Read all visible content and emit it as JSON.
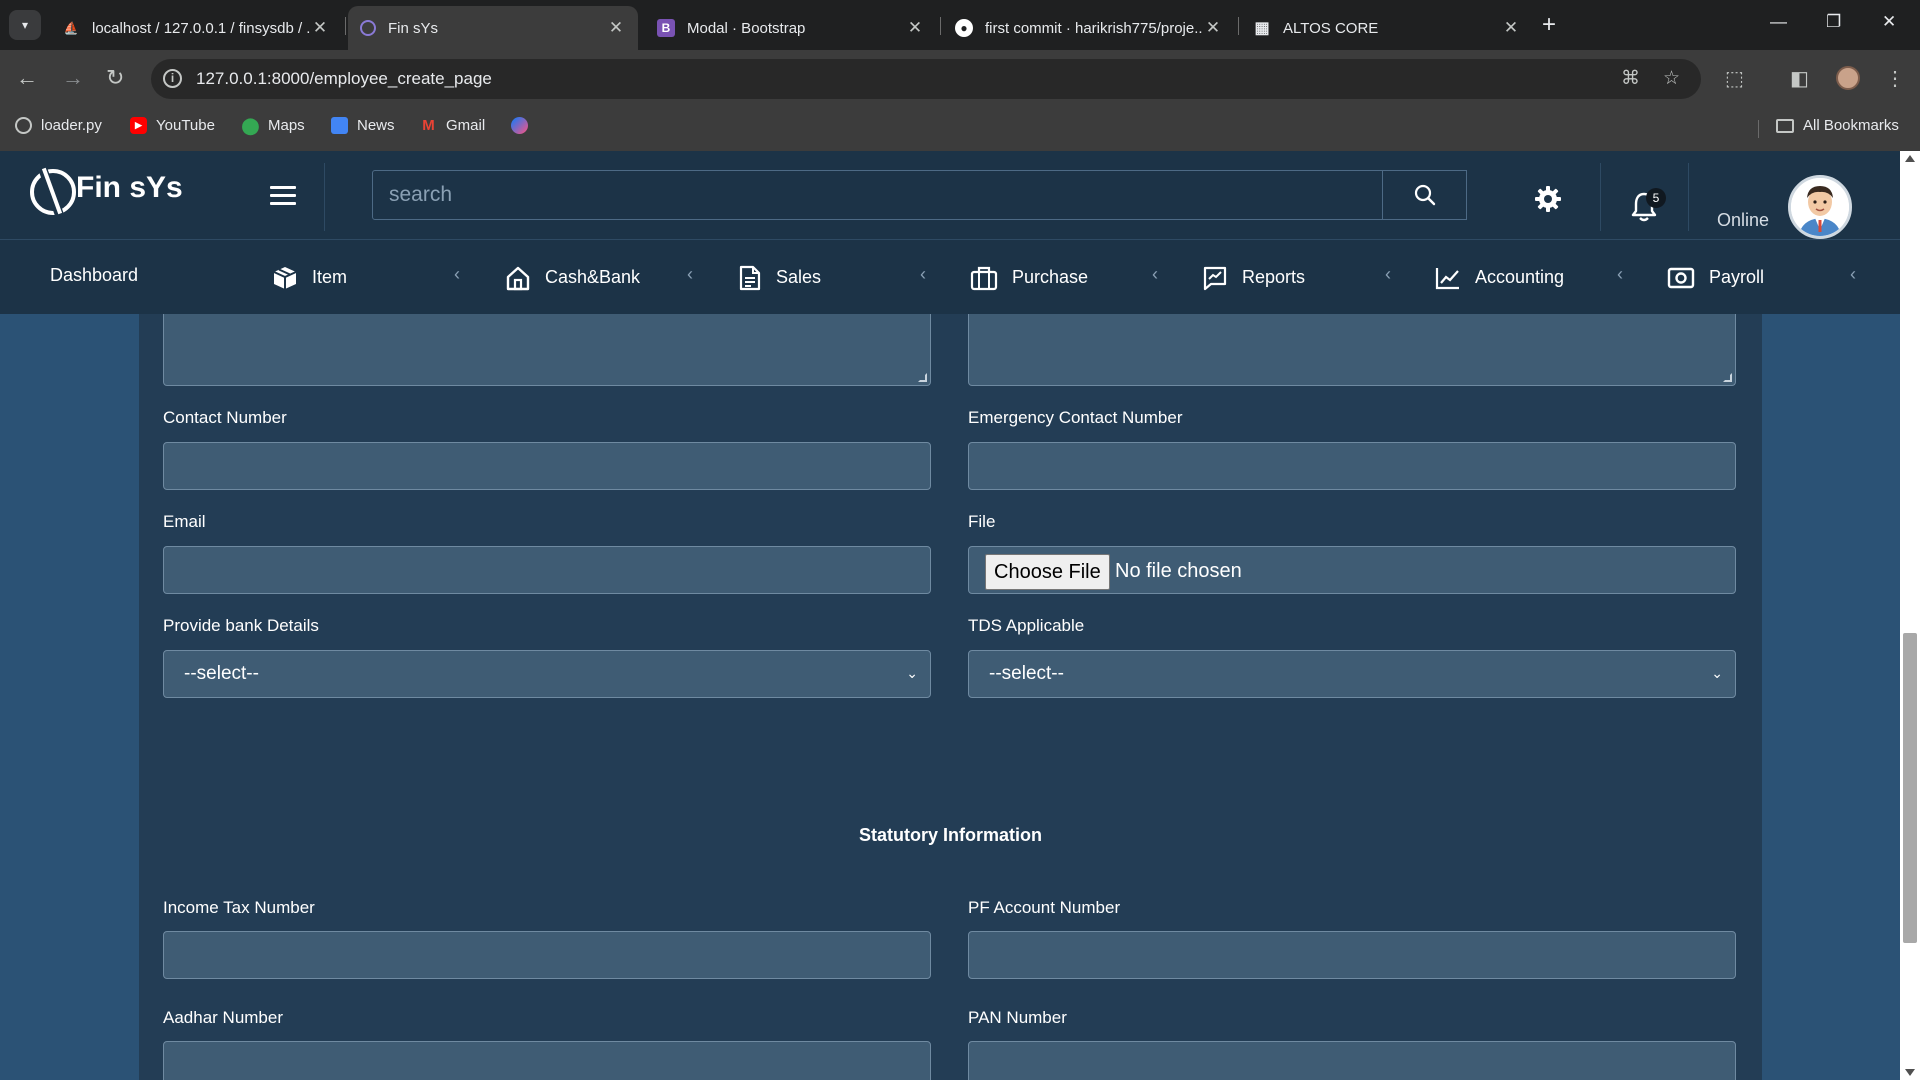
{
  "browser": {
    "tabs": [
      {
        "title": "localhost / 127.0.0.1 / finsysdb / ...",
        "icon": "phpmyadmin-icon"
      },
      {
        "title": "Fin sYs",
        "icon": "app-icon"
      },
      {
        "title": "Modal · Bootstrap",
        "icon": "bootstrap-icon"
      },
      {
        "title": "first commit · harikrish775/proje...",
        "icon": "github-icon"
      },
      {
        "title": "ALTOS CORE",
        "icon": "grid-icon"
      }
    ],
    "active_tab": 1,
    "url": "127.0.0.1:8000/employee_create_page",
    "bookmarks": [
      {
        "label": "loader.py",
        "icon": "globe-icon"
      },
      {
        "label": "YouTube",
        "icon": "youtube-icon"
      },
      {
        "label": "Maps",
        "icon": "maps-icon"
      },
      {
        "label": "News",
        "icon": "news-icon"
      },
      {
        "label": "Gmail",
        "icon": "gmail-icon"
      },
      {
        "label": "",
        "icon": "messenger-icon"
      }
    ],
    "all_bookmarks": "All Bookmarks"
  },
  "app": {
    "brand": "Fin sYs",
    "search_placeholder": "search",
    "notification_count": "5",
    "status": "Online"
  },
  "nav": [
    {
      "label": "Dashboard",
      "icon": ""
    },
    {
      "label": "Item",
      "icon": "box-icon"
    },
    {
      "label": "Cash&Bank",
      "icon": "home-icon"
    },
    {
      "label": "Sales",
      "icon": "document-icon"
    },
    {
      "label": "Purchase",
      "icon": "briefcase-icon"
    },
    {
      "label": "Reports",
      "icon": "chart-box-icon"
    },
    {
      "label": "Accounting",
      "icon": "line-chart-icon"
    },
    {
      "label": "Payroll",
      "icon": "camera-icon"
    }
  ],
  "form": {
    "contact_number": {
      "label": "Contact Number",
      "value": ""
    },
    "emergency_contact": {
      "label": "Emergency Contact Number",
      "value": ""
    },
    "email": {
      "label": "Email",
      "value": ""
    },
    "file": {
      "label": "File",
      "button": "Choose File",
      "status": "No file chosen"
    },
    "bank_details": {
      "label": "Provide bank Details",
      "selected": "--select--"
    },
    "tds": {
      "label": "TDS Applicable",
      "selected": "--select--"
    },
    "statutory_title": "Statutory Information",
    "income_tax": {
      "label": "Income Tax Number",
      "value": ""
    },
    "pf_account": {
      "label": "PF Account Number",
      "value": ""
    },
    "aadhar": {
      "label": "Aadhar Number",
      "value": ""
    },
    "pan": {
      "label": "PAN Number",
      "value": ""
    }
  },
  "colors": {
    "page_bg": "#2b5275",
    "header_bg": "#1c3347",
    "card_bg": "#233d55",
    "input_bg": "#3f5c74"
  }
}
